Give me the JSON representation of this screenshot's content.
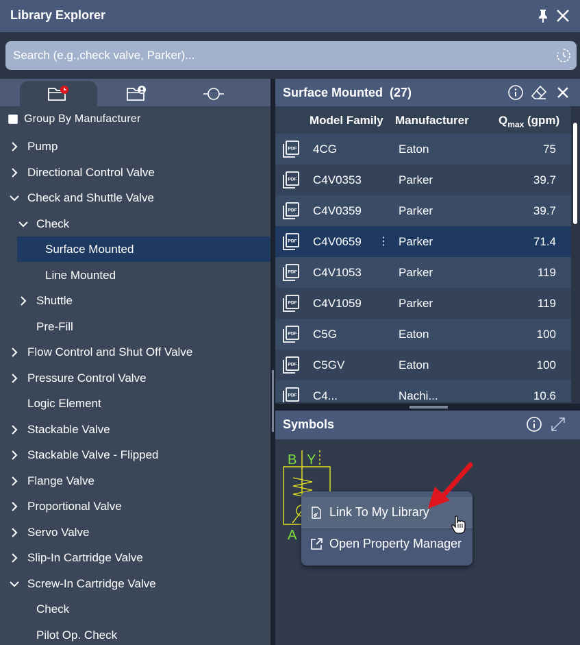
{
  "window": {
    "title": "Library Explorer"
  },
  "search": {
    "placeholder": "Search (e.g.,check valve, Parker)..."
  },
  "left_panel": {
    "tabs": [
      {
        "icon": "folder-clock-icon",
        "active": true
      },
      {
        "icon": "folder-user-icon",
        "active": false
      },
      {
        "icon": "symbol-icon",
        "active": false
      }
    ],
    "group_by_label": "Group By Manufacturer",
    "group_by_checked": false,
    "tree": [
      {
        "label": "Pump",
        "expander": "collapsed"
      },
      {
        "label": "Directional Control Valve",
        "expander": "collapsed"
      },
      {
        "label": "Check and Shuttle Valve",
        "expander": "expanded"
      },
      {
        "label": "Check",
        "expander": "expanded"
      },
      {
        "label": "Surface Mounted",
        "expander": "none",
        "selected": true
      },
      {
        "label": "Line Mounted",
        "expander": "none"
      },
      {
        "label": "Shuttle",
        "expander": "collapsed"
      },
      {
        "label": "Pre-Fill",
        "expander": "none"
      },
      {
        "label": "Flow Control and Shut Off Valve",
        "expander": "collapsed"
      },
      {
        "label": "Pressure Control Valve",
        "expander": "collapsed"
      },
      {
        "label": "Logic Element",
        "expander": "none"
      },
      {
        "label": "Stackable Valve",
        "expander": "collapsed"
      },
      {
        "label": "Stackable Valve - Flipped",
        "expander": "collapsed"
      },
      {
        "label": "Flange Valve",
        "expander": "collapsed"
      },
      {
        "label": "Proportional Valve",
        "expander": "collapsed"
      },
      {
        "label": "Servo Valve",
        "expander": "collapsed"
      },
      {
        "label": "Slip-In Cartridge Valve",
        "expander": "collapsed"
      },
      {
        "label": "Screw-In Cartridge Valve",
        "expander": "expanded"
      },
      {
        "label": "Check",
        "expander": "none"
      },
      {
        "label": "Pilot Op. Check",
        "expander": "none"
      }
    ]
  },
  "results": {
    "title": "Surface Mounted",
    "count": "(27)",
    "columns": {
      "model": "Model Family",
      "manufacturer": "Manufacturer",
      "q_main": "Q",
      "q_sub": "max",
      "q_unit": " (gpm)"
    },
    "rows": [
      {
        "model": "4CG",
        "manufacturer": "Eaton",
        "qmax": "75"
      },
      {
        "model": "C4V0353",
        "manufacturer": "Parker",
        "qmax": "39.7"
      },
      {
        "model": "C4V0359",
        "manufacturer": "Parker",
        "qmax": "39.7"
      },
      {
        "model": "C4V0659",
        "manufacturer": "Parker",
        "qmax": "71.4",
        "selected": true,
        "kebab": "⋮"
      },
      {
        "model": "C4V1053",
        "manufacturer": "Parker",
        "qmax": "119"
      },
      {
        "model": "C4V1059",
        "manufacturer": "Parker",
        "qmax": "119"
      },
      {
        "model": "C5G",
        "manufacturer": "Eaton",
        "qmax": "100"
      },
      {
        "model": "C5GV",
        "manufacturer": "Eaton",
        "qmax": "100"
      },
      {
        "model": "C4...",
        "manufacturer": "Nachi...",
        "qmax": "10.6"
      }
    ],
    "pdf_icon_text": "PDF"
  },
  "symbols": {
    "title": "Symbols",
    "ports": {
      "b": "B",
      "y": "Y",
      "a": "A"
    },
    "line_color": "#e8e81e",
    "label_color": "#7cdc3c"
  },
  "context_menu": {
    "items": [
      {
        "label": "Link To My Library",
        "icon": "link-document-icon",
        "hovered": true
      },
      {
        "label": "Open Property Manager",
        "icon": "external-link-icon",
        "hovered": false
      }
    ]
  },
  "colors": {
    "accent": "#49597a",
    "selected": "#1f3a61",
    "arrow": "#e0141c"
  }
}
